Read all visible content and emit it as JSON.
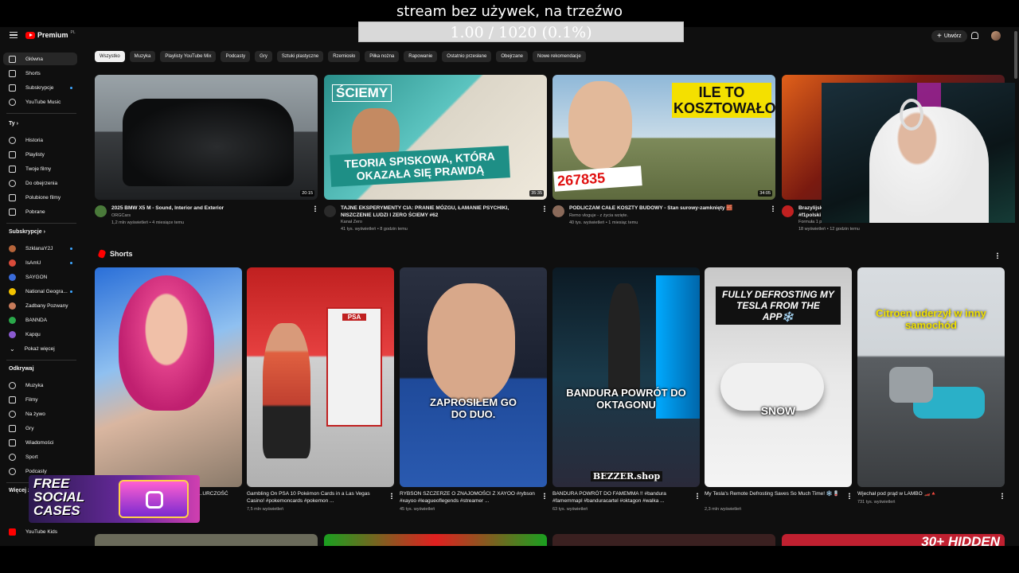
{
  "overlay": {
    "title": "stream bez używek, na trzeźwo",
    "progress": "1.00 / 1020 (0.1%)"
  },
  "header": {
    "logo": "Premium",
    "logo_country": "PL",
    "create_label": "Utwórz"
  },
  "sidebar": {
    "main": [
      {
        "label": "Główna",
        "icon": "home-icon"
      },
      {
        "label": "Shorts",
        "icon": "shorts-icon"
      },
      {
        "label": "Subskrypcje",
        "icon": "subscriptions-icon"
      },
      {
        "label": "YouTube Music",
        "icon": "music-icon"
      }
    ],
    "you_header": "Ty",
    "you": [
      {
        "label": "Historia",
        "icon": "history-icon"
      },
      {
        "label": "Playlisty",
        "icon": "playlist-icon"
      },
      {
        "label": "Twoje filmy",
        "icon": "video-icon"
      },
      {
        "label": "Do obejrzenia",
        "icon": "clock-icon"
      },
      {
        "label": "Polubione filmy",
        "icon": "like-icon"
      },
      {
        "label": "Pobrane",
        "icon": "download-icon"
      }
    ],
    "subs_header": "Subskrypcje",
    "subs": [
      {
        "label": "SzklanaY2J",
        "color": "#b5643a"
      },
      {
        "label": "IsAmU",
        "color": "#d94b3a"
      },
      {
        "label": "SAYGON",
        "color": "#3a6bd9"
      },
      {
        "label": "National Geogra...",
        "color": "#f2c200"
      },
      {
        "label": "Zadbany Pozwany",
        "color": "#c77b5a"
      },
      {
        "label": "BANNDA",
        "color": "#2aa84a"
      },
      {
        "label": "Kapqu",
        "color": "#8a5ad0"
      },
      {
        "label": "Pokaż więcej",
        "color": ""
      }
    ],
    "explore_header": "Odkrywaj",
    "explore": [
      {
        "label": "Muzyka",
        "icon": "music-note-icon"
      },
      {
        "label": "Filmy",
        "icon": "film-icon"
      },
      {
        "label": "Na żywo",
        "icon": "live-icon"
      },
      {
        "label": "Gry",
        "icon": "game-icon"
      },
      {
        "label": "Wiadomości",
        "icon": "news-icon"
      },
      {
        "label": "Sport",
        "icon": "trophy-icon"
      },
      {
        "label": "Podcasty",
        "icon": "podcast-icon"
      }
    ],
    "more_header": "Więcej z",
    "more": [
      {
        "label": "YouTube Kids"
      }
    ]
  },
  "chips": [
    "Wszystko",
    "Muzyka",
    "Playlisty YouTube Mix",
    "Podcasty",
    "Gry",
    "Sztuki plastyczne",
    "Rzemiosło",
    "Piłka nożna",
    "Rapowanie",
    "Ostatnio przesłane",
    "Obejrzane",
    "Nowe rekomendacje"
  ],
  "videos": [
    {
      "title": "2025 BMW X5 M - Sound, Interior and Exterior",
      "channel": "ORGCars",
      "stats": "1,2 mln wyświetleń • 4 miesiące temu",
      "duration": "20:15",
      "avatar": "#4a7a3a"
    },
    {
      "title": "TAJNE EKSPERYMENTY CIA: PRANIE MÓZGU, ŁAMANIE PSYCHIKI, NISZCZENIE LUDZI I ZERO ŚCIEMY #62",
      "channel": "Kanał Zero",
      "stats": "41 tys. wyświetleń • 8 godzin temu",
      "duration": "35:35",
      "thumb_text1": "ŚCIEMY",
      "thumb_text2": "TEORIA SPISKOWA, KTÓRA OKAZAŁA SIĘ PRAWDĄ",
      "avatar": "#2a2a2a"
    },
    {
      "title": "PODLICZAM CAŁE KOSZTY BUDOWY - Stan surowy-zamknięty 🧱",
      "channel": "Remo vloguje - z życia wzięte.",
      "stats": "40 tys. wyświetleń • 1 miesiąc temu",
      "duration": "34:05",
      "thumb_text1": "ILE TO KOSZTOWAŁO?",
      "thumb_text2": "267835",
      "avatar": "#8a6a5a"
    },
    {
      "title": "Brazylijsk",
      "title2": "#f1polski",
      "channel": "Formuła 1 po Polsku",
      "stats": "18 wyświetleń • 12 godzin temu",
      "avatar": "#c02020"
    }
  ],
  "shorts_header": "Shorts",
  "shorts": [
    {
      "title": "...URCZOŚĆ",
      "views": ""
    },
    {
      "title": "Gambling On PSA 10 Pokémon Cards in a Las Vegas Casino! #pokemoncards #pokemon ...",
      "views": "7,5 mln wyświetleń",
      "cap": "PSA"
    },
    {
      "title": "RYBSON SZCZERZE O ZNAJOMOŚCI Z XAYOO #rybson #xayoo #leagueoflegends #streamer ...",
      "views": "45 tys. wyświetleń",
      "cap": "ZAPROSIŁEM GO DO DUO."
    },
    {
      "title": "BANDURA POWRÓT DO FAMEMMA !! #bandura #famemmapl #banduracartel #oktagon #walka ...",
      "views": "63 tys. wyświetleń",
      "cap": "BANDURA POWRÓT DO OKTAGONU",
      "cap2": "BEZZER.shop"
    },
    {
      "title": "My Tesla's Remote Defrosting Saves So Much Time! ❄️🪫",
      "views": "2,3 mln wyświetleń",
      "cap": "FULLY DEFROSTING MY TESLA FROM THE APP❄️",
      "cap2": "SNOW"
    },
    {
      "title": "Wjechał pod prąd w LAMBO 🏎️🔺",
      "views": "731 tys. wyświetleń",
      "cap": "Citroen uderzył w inny samochód"
    }
  ],
  "promo": {
    "text": "FREE SOCIAL CASES"
  },
  "bottom_peek": "30+ HIDDEN"
}
